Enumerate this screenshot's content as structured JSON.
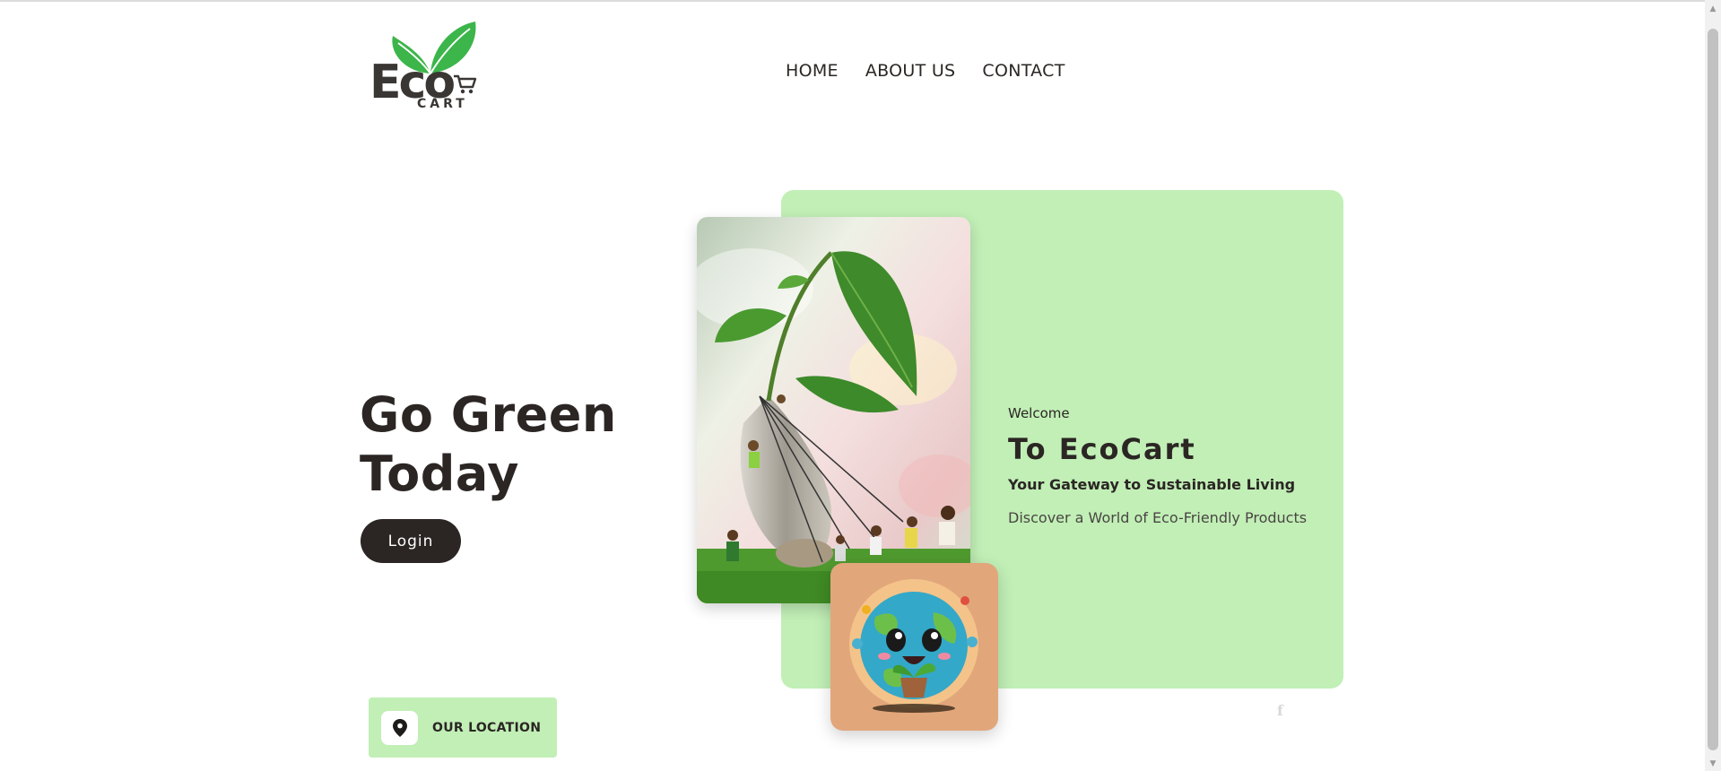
{
  "brand": {
    "logo_word": "Eco",
    "logo_sub": "CART",
    "green": "#3cb54a"
  },
  "nav": {
    "items": [
      "HOME",
      "ABOUT US",
      "CONTACT"
    ]
  },
  "hero": {
    "title_line1": "Go Green",
    "title_line2": "Today",
    "login_label": "Login"
  },
  "panel": {
    "welcome": "Welcome",
    "heading": "To EcoCart",
    "subtitle": "Your Gateway to Sustainable Living",
    "description": "Discover a World of Eco-Friendly Products",
    "background": "#c1efb6"
  },
  "location": {
    "label": "OUR LOCATION",
    "icon": "map-pin-icon"
  },
  "social": {
    "icon": "facebook-icon",
    "glyph": "f"
  },
  "colors": {
    "dark": "#2b2624",
    "light_green": "#c1efb6",
    "peach": "#e2a67b"
  }
}
